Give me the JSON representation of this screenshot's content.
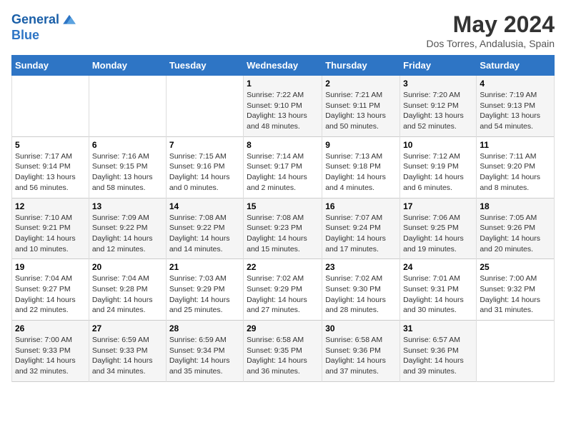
{
  "logo": {
    "line1": "General",
    "line2": "Blue"
  },
  "title": "May 2024",
  "subtitle": "Dos Torres, Andalusia, Spain",
  "weekdays": [
    "Sunday",
    "Monday",
    "Tuesday",
    "Wednesday",
    "Thursday",
    "Friday",
    "Saturday"
  ],
  "weeks": [
    [
      {
        "day": "",
        "info": ""
      },
      {
        "day": "",
        "info": ""
      },
      {
        "day": "",
        "info": ""
      },
      {
        "day": "1",
        "info": "Sunrise: 7:22 AM\nSunset: 9:10 PM\nDaylight: 13 hours\nand 48 minutes."
      },
      {
        "day": "2",
        "info": "Sunrise: 7:21 AM\nSunset: 9:11 PM\nDaylight: 13 hours\nand 50 minutes."
      },
      {
        "day": "3",
        "info": "Sunrise: 7:20 AM\nSunset: 9:12 PM\nDaylight: 13 hours\nand 52 minutes."
      },
      {
        "day": "4",
        "info": "Sunrise: 7:19 AM\nSunset: 9:13 PM\nDaylight: 13 hours\nand 54 minutes."
      }
    ],
    [
      {
        "day": "5",
        "info": "Sunrise: 7:17 AM\nSunset: 9:14 PM\nDaylight: 13 hours\nand 56 minutes."
      },
      {
        "day": "6",
        "info": "Sunrise: 7:16 AM\nSunset: 9:15 PM\nDaylight: 13 hours\nand 58 minutes."
      },
      {
        "day": "7",
        "info": "Sunrise: 7:15 AM\nSunset: 9:16 PM\nDaylight: 14 hours\nand 0 minutes."
      },
      {
        "day": "8",
        "info": "Sunrise: 7:14 AM\nSunset: 9:17 PM\nDaylight: 14 hours\nand 2 minutes."
      },
      {
        "day": "9",
        "info": "Sunrise: 7:13 AM\nSunset: 9:18 PM\nDaylight: 14 hours\nand 4 minutes."
      },
      {
        "day": "10",
        "info": "Sunrise: 7:12 AM\nSunset: 9:19 PM\nDaylight: 14 hours\nand 6 minutes."
      },
      {
        "day": "11",
        "info": "Sunrise: 7:11 AM\nSunset: 9:20 PM\nDaylight: 14 hours\nand 8 minutes."
      }
    ],
    [
      {
        "day": "12",
        "info": "Sunrise: 7:10 AM\nSunset: 9:21 PM\nDaylight: 14 hours\nand 10 minutes."
      },
      {
        "day": "13",
        "info": "Sunrise: 7:09 AM\nSunset: 9:22 PM\nDaylight: 14 hours\nand 12 minutes."
      },
      {
        "day": "14",
        "info": "Sunrise: 7:08 AM\nSunset: 9:22 PM\nDaylight: 14 hours\nand 14 minutes."
      },
      {
        "day": "15",
        "info": "Sunrise: 7:08 AM\nSunset: 9:23 PM\nDaylight: 14 hours\nand 15 minutes."
      },
      {
        "day": "16",
        "info": "Sunrise: 7:07 AM\nSunset: 9:24 PM\nDaylight: 14 hours\nand 17 minutes."
      },
      {
        "day": "17",
        "info": "Sunrise: 7:06 AM\nSunset: 9:25 PM\nDaylight: 14 hours\nand 19 minutes."
      },
      {
        "day": "18",
        "info": "Sunrise: 7:05 AM\nSunset: 9:26 PM\nDaylight: 14 hours\nand 20 minutes."
      }
    ],
    [
      {
        "day": "19",
        "info": "Sunrise: 7:04 AM\nSunset: 9:27 PM\nDaylight: 14 hours\nand 22 minutes."
      },
      {
        "day": "20",
        "info": "Sunrise: 7:04 AM\nSunset: 9:28 PM\nDaylight: 14 hours\nand 24 minutes."
      },
      {
        "day": "21",
        "info": "Sunrise: 7:03 AM\nSunset: 9:29 PM\nDaylight: 14 hours\nand 25 minutes."
      },
      {
        "day": "22",
        "info": "Sunrise: 7:02 AM\nSunset: 9:29 PM\nDaylight: 14 hours\nand 27 minutes."
      },
      {
        "day": "23",
        "info": "Sunrise: 7:02 AM\nSunset: 9:30 PM\nDaylight: 14 hours\nand 28 minutes."
      },
      {
        "day": "24",
        "info": "Sunrise: 7:01 AM\nSunset: 9:31 PM\nDaylight: 14 hours\nand 30 minutes."
      },
      {
        "day": "25",
        "info": "Sunrise: 7:00 AM\nSunset: 9:32 PM\nDaylight: 14 hours\nand 31 minutes."
      }
    ],
    [
      {
        "day": "26",
        "info": "Sunrise: 7:00 AM\nSunset: 9:33 PM\nDaylight: 14 hours\nand 32 minutes."
      },
      {
        "day": "27",
        "info": "Sunrise: 6:59 AM\nSunset: 9:33 PM\nDaylight: 14 hours\nand 34 minutes."
      },
      {
        "day": "28",
        "info": "Sunrise: 6:59 AM\nSunset: 9:34 PM\nDaylight: 14 hours\nand 35 minutes."
      },
      {
        "day": "29",
        "info": "Sunrise: 6:58 AM\nSunset: 9:35 PM\nDaylight: 14 hours\nand 36 minutes."
      },
      {
        "day": "30",
        "info": "Sunrise: 6:58 AM\nSunset: 9:36 PM\nDaylight: 14 hours\nand 37 minutes."
      },
      {
        "day": "31",
        "info": "Sunrise: 6:57 AM\nSunset: 9:36 PM\nDaylight: 14 hours\nand 39 minutes."
      },
      {
        "day": "",
        "info": ""
      }
    ]
  ]
}
